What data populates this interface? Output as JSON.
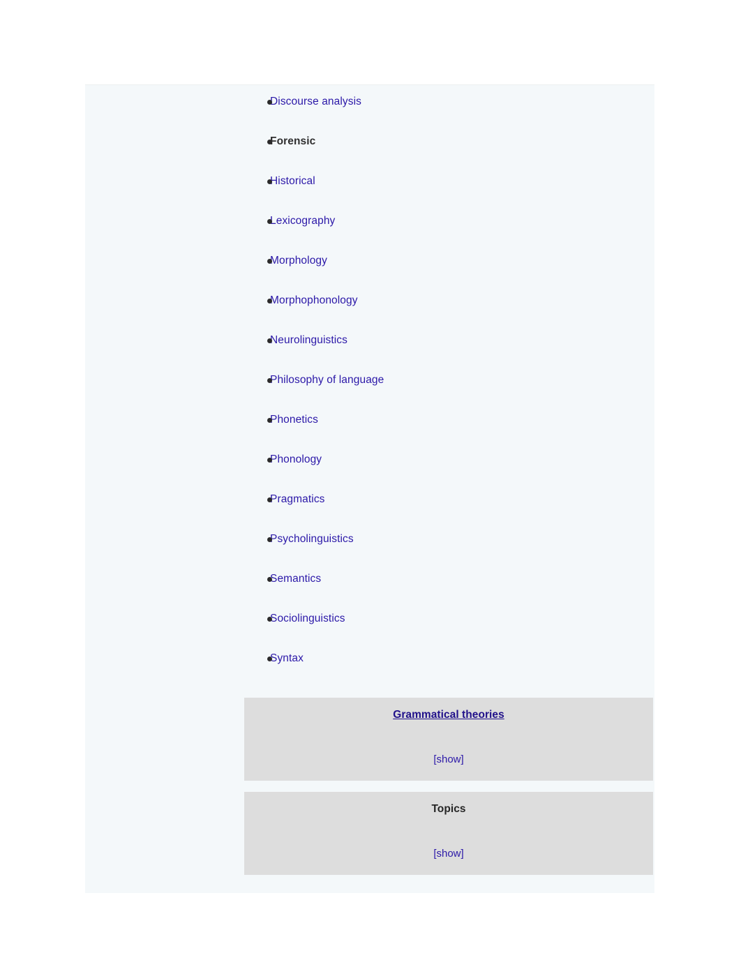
{
  "infobox": {
    "subfields": {
      "items": [
        {
          "label": "Discourse analysis",
          "current": false
        },
        {
          "label": "Forensic",
          "current": true
        },
        {
          "label": "Historical",
          "current": false
        },
        {
          "label": "Lexicography",
          "current": false
        },
        {
          "label": "Morphology",
          "current": false
        },
        {
          "label": "Morphophonology",
          "current": false
        },
        {
          "label": "Neurolinguistics",
          "current": false
        },
        {
          "label": "Philosophy of language",
          "current": false
        },
        {
          "label": "Phonetics",
          "current": false
        },
        {
          "label": "Phonology",
          "current": false
        },
        {
          "label": "Pragmatics",
          "current": false
        },
        {
          "label": "Psycholinguistics",
          "current": false
        },
        {
          "label": "Semantics",
          "current": false
        },
        {
          "label": "Sociolinguistics",
          "current": false
        },
        {
          "label": "Syntax",
          "current": false
        }
      ]
    },
    "navboxes": [
      {
        "title": "Grammatical theories",
        "title_is_link": true,
        "toggle_label": "[show]"
      },
      {
        "title": "Topics",
        "title_is_link": false,
        "toggle_label": "[show]"
      }
    ]
  },
  "colors": {
    "panel_background": "#f4f8fa",
    "navbox_background": "#dddddd",
    "link": "#2b18a8",
    "navbox_title_link": "#20108a",
    "current_item": "#2f2f2f",
    "bullet": "#2b2b2b",
    "page_background": "#ffffff"
  }
}
